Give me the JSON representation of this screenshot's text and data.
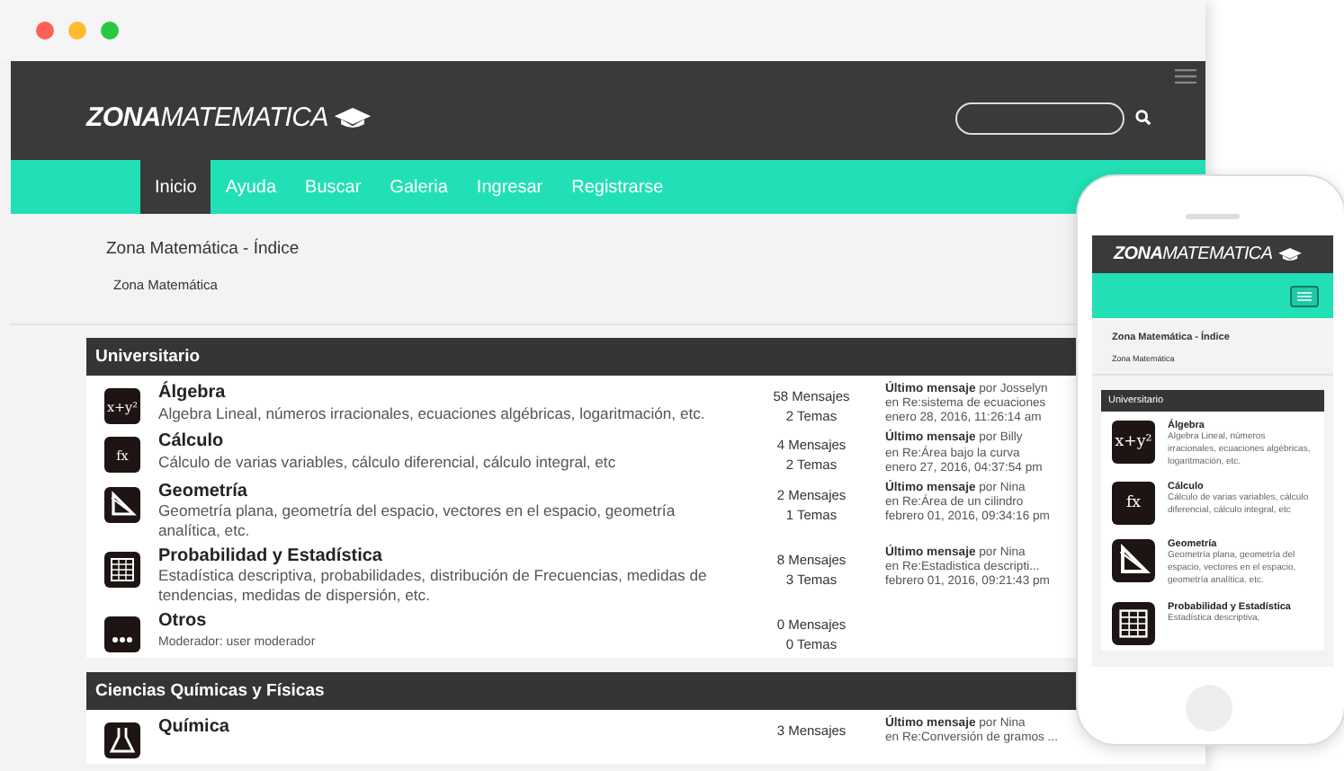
{
  "site": {
    "logo": {
      "bold": "ZONA",
      "light": "MATEMATICA"
    },
    "nav": [
      {
        "label": "Inicio",
        "selected": true
      },
      {
        "label": "Ayuda",
        "selected": false
      },
      {
        "label": "Buscar",
        "selected": false
      },
      {
        "label": "Galeria",
        "selected": false
      },
      {
        "label": "Ingresar",
        "selected": false
      },
      {
        "label": "Registrarse",
        "selected": false
      }
    ],
    "breadcrumb": {
      "title": "Zona Matemática - Índice",
      "link": "Zona Matemática"
    },
    "categories": [
      {
        "title": "Universitario",
        "boards": [
          {
            "kind": "formula",
            "glyph": "x+y²",
            "name": "Álgebra",
            "description": "Algebra Lineal, números irracionales, ecuaciones algébricas, logaritmación, etc.",
            "messages": "58 Mensajes",
            "topics": "2 Temas",
            "last": {
              "label": "Último mensaje",
              "by": "por Josselyn",
              "topic": "en Re:sistema de ecuaciones",
              "date": "enero 28, 2016, 11:26:14 am"
            }
          },
          {
            "kind": "formula",
            "glyph": "fx",
            "name": "Cálculo",
            "description": "Cálculo de varias variables, cálculo diferencial, cálculo integral, etc",
            "messages": "4 Mensajes",
            "topics": "2 Temas",
            "last": {
              "label": "Último mensaje",
              "by": "por Billy",
              "topic": "en Re:Área bajo la curva",
              "date": "enero 27, 2016, 04:37:54 pm"
            }
          },
          {
            "kind": "triangle",
            "name": "Geometría",
            "description": "Geometría plana, geometría del espacio, vectores en el espacio, geometría analítica, etc.",
            "messages": "2 Mensajes",
            "topics": "1 Temas",
            "last": {
              "label": "Último mensaje",
              "by": "por Nina",
              "topic": "en Re:Área de un cilindro",
              "date": "febrero 01, 2016, 09:34:16 pm"
            }
          },
          {
            "kind": "table",
            "name": "Probabilidad y Estadística",
            "description": "Estadística descriptiva, probabilidades, distribución de Frecuencias, medidas de tendencias, medidas de dispersión, etc.",
            "messages": "8 Mensajes",
            "topics": "3 Temas",
            "last": {
              "label": "Último mensaje",
              "by": "por Nina",
              "topic": "en Re:Estadistica descripti...",
              "date": "febrero 01, 2016, 09:21:43 pm"
            }
          },
          {
            "kind": "dots",
            "name": "Otros",
            "moderator": "Moderador: user moderador",
            "messages": "0 Mensajes",
            "topics": "0 Temas"
          }
        ]
      },
      {
        "title": "Ciencias Químicas y Físicas",
        "boards": [
          {
            "kind": "flask",
            "name": "Química",
            "messages": "3 Mensajes",
            "last": {
              "label": "Último mensaje",
              "by": "por Nina",
              "topic": "en Re:Conversión de gramos ..."
            }
          }
        ]
      }
    ]
  },
  "phone": {
    "logo": {
      "bold": "ZONA",
      "light": "MATEMATICA"
    },
    "breadcrumb": {
      "title": "Zona Matemática - Índice",
      "link": "Zona Matemática"
    },
    "category": "Universitario",
    "boards": [
      {
        "kind": "formula",
        "glyph": "x+y²",
        "name": "Álgebra",
        "description": "Algebra Lineal, números irracionales, ecuaciones algébricas, logaritmación, etc."
      },
      {
        "kind": "formula",
        "glyph": "fx",
        "name": "Cálculo",
        "description": "Cálculo de varias variables, cálculo diferencial, cálculo integral, etc"
      },
      {
        "kind": "triangle",
        "name": "Geometría",
        "description": "Geometría plana, geometría del espacio, vectores en el espacio, geometría analítica, etc."
      },
      {
        "kind": "table",
        "name": "Probabilidad y Estadística",
        "description": "Estadística descriptiva,"
      }
    ]
  }
}
